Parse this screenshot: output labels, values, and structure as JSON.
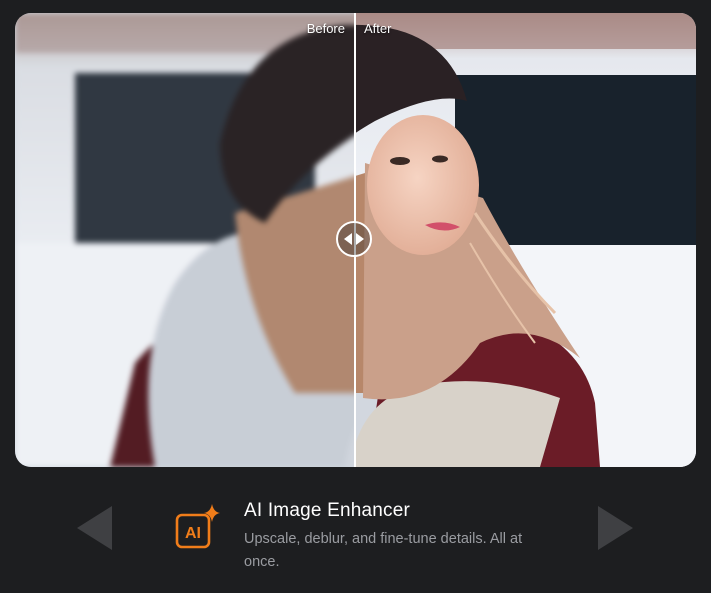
{
  "viewer": {
    "before_label": "Before",
    "after_label": "After",
    "split_position": 0.5
  },
  "feature": {
    "icon_text": "AI",
    "title": "AI Image Enhancer",
    "description": "Upscale, deblur, and fine-tune details. All at once."
  },
  "navigation": {
    "prev_icon": "triangle-left-icon",
    "next_icon": "triangle-right-icon"
  },
  "colors": {
    "background": "#1d1e20",
    "accent": "#f07d1a",
    "title": "#ffffff",
    "description": "#9a9ca1",
    "arrow": "#3f4043"
  }
}
